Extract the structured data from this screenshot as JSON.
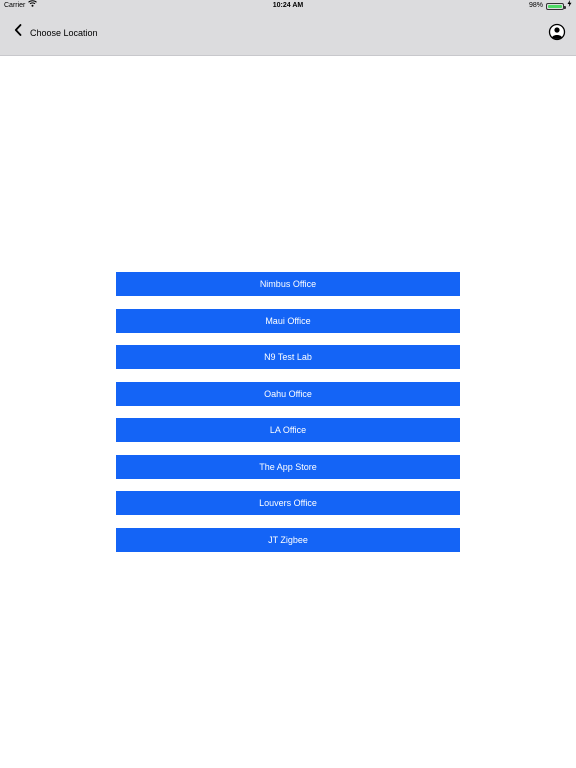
{
  "status_bar": {
    "carrier": "Carrier",
    "time": "10:24 AM",
    "battery": "98%"
  },
  "nav": {
    "title": "Choose Location"
  },
  "locations": [
    {
      "label": "Nimbus Office"
    },
    {
      "label": "Maui Office"
    },
    {
      "label": "N9 Test Lab"
    },
    {
      "label": "Oahu Office"
    },
    {
      "label": "LA Office"
    },
    {
      "label": "The App Store"
    },
    {
      "label": "Louvers Office"
    },
    {
      "label": "JT Zigbee"
    }
  ],
  "colors": {
    "header_bg": "#dcdcde",
    "button_bg": "#1464f6",
    "button_text": "#ffffff",
    "battery": "#4cd964"
  }
}
